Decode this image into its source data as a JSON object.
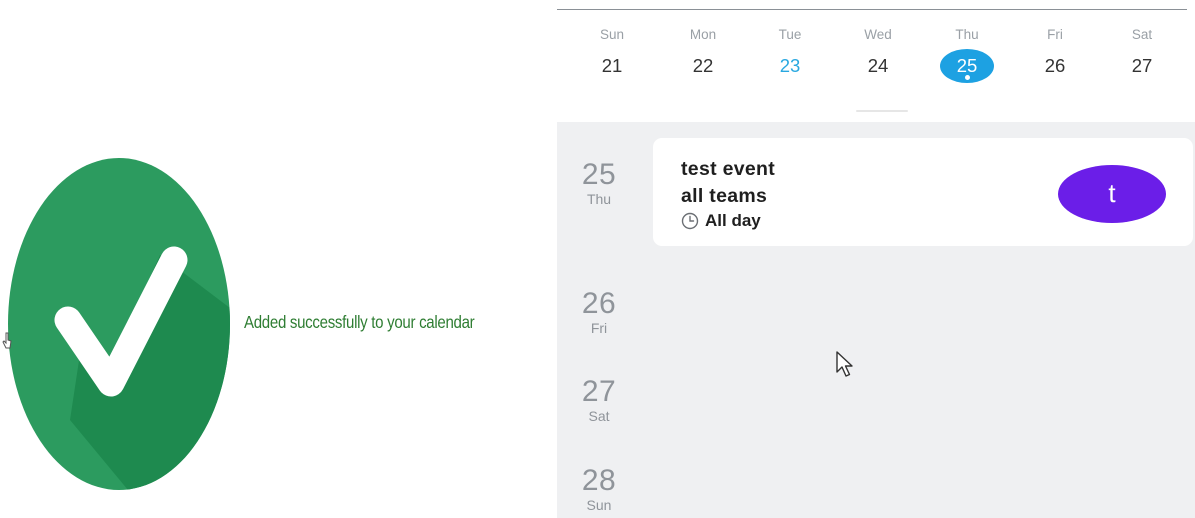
{
  "success": {
    "message": "Added successfully to your calendar",
    "badge_color": "#2c9b5f",
    "message_color": "#2e7d32"
  },
  "calendar": {
    "week": [
      {
        "weekday": "Sun",
        "day": "21"
      },
      {
        "weekday": "Mon",
        "day": "22"
      },
      {
        "weekday": "Tue",
        "day": "23",
        "state": "today"
      },
      {
        "weekday": "Wed",
        "day": "24"
      },
      {
        "weekday": "Thu",
        "day": "25",
        "state": "selected",
        "has_event": true
      },
      {
        "weekday": "Fri",
        "day": "26"
      },
      {
        "weekday": "Sat",
        "day": "27"
      }
    ],
    "dates": [
      {
        "day": "25",
        "weekday": "Thu"
      },
      {
        "day": "26",
        "weekday": "Fri"
      },
      {
        "day": "27",
        "weekday": "Sat"
      },
      {
        "day": "28",
        "weekday": "Sun"
      }
    ],
    "event": {
      "title_line1": "test event",
      "title_line2": "all teams",
      "time_label": "All day",
      "time_icon": "clock-icon",
      "avatar_letter": "t",
      "avatar_color": "#6b1ee8"
    },
    "selected_color": "#1da1e2",
    "today_color": "#29a8e0"
  }
}
